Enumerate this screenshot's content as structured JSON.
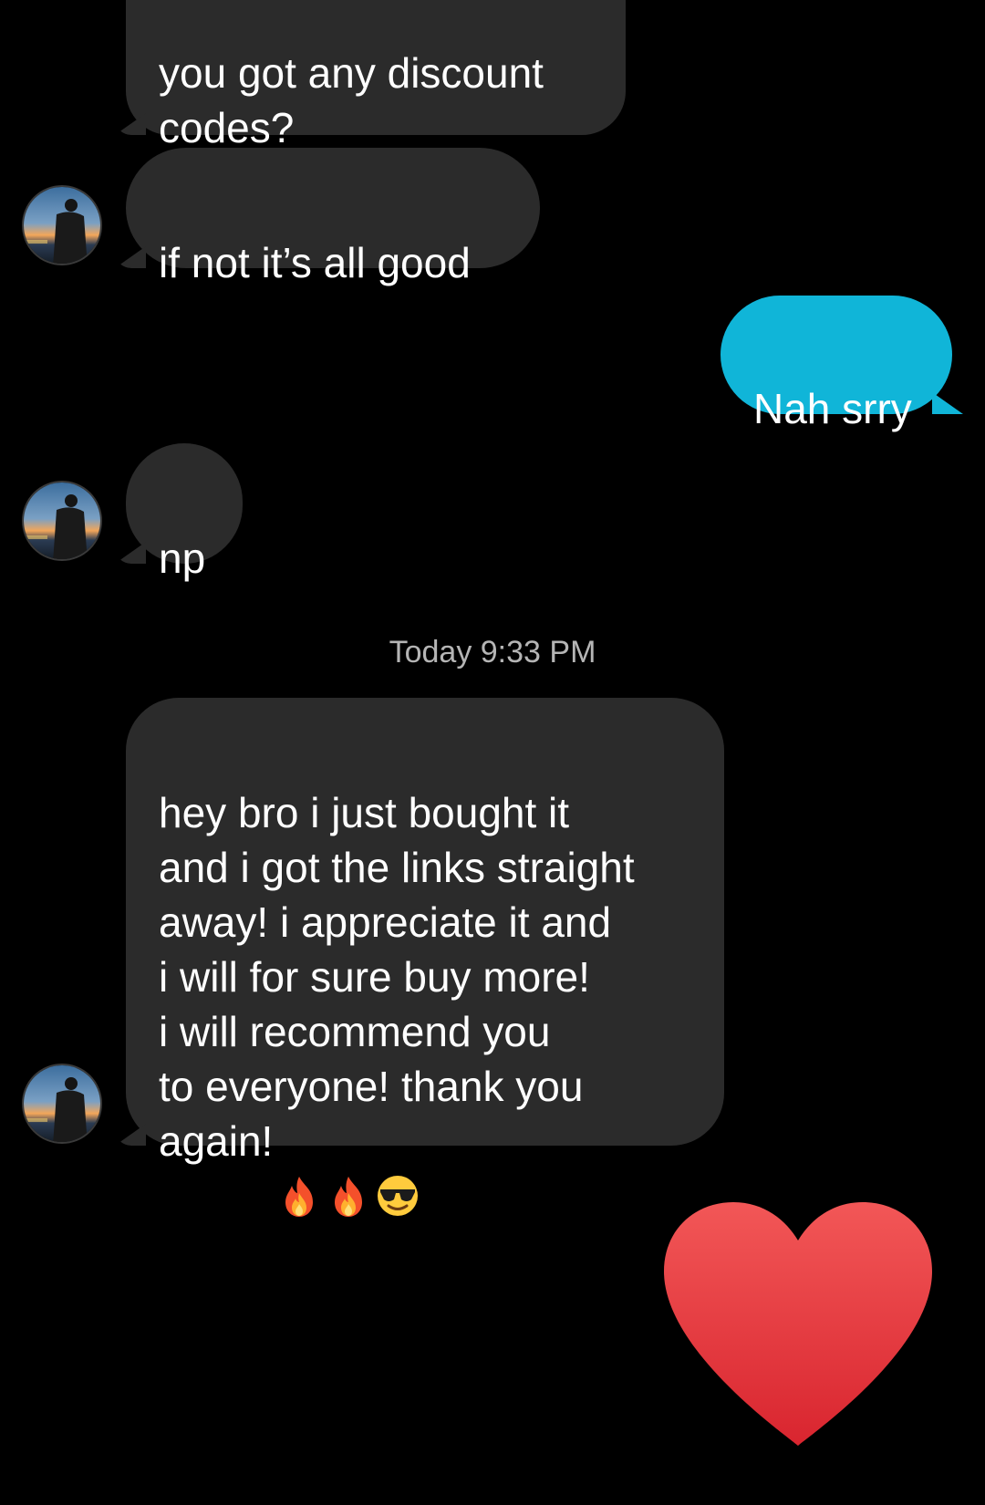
{
  "messages": [
    {
      "id": "m1",
      "direction": "incoming",
      "text": "you got any discount\ncodes?"
    },
    {
      "id": "m2",
      "direction": "incoming",
      "text": "if not it’s all good"
    },
    {
      "id": "m3",
      "direction": "outgoing",
      "text": "Nah srry"
    },
    {
      "id": "m4",
      "direction": "incoming",
      "text": "np"
    },
    {
      "id": "m5",
      "direction": "incoming",
      "text": "hey bro i just bought it\nand i got the links straight\naway! i appreciate it and\ni will for sure buy more!\ni will recommend you\nto everyone! thank you\nagain!"
    }
  ],
  "timestamp": "Today 9:33 PM",
  "m5_emojis": [
    "fire-emoji",
    "fire-emoji",
    "sunglasses-emoji"
  ],
  "heart_reaction": "heart-icon",
  "colors": {
    "background": "#000000",
    "incoming_bubble": "#2b2b2b",
    "outgoing_bubble": "#10b5d8",
    "timestamp_text": "#b5b5b5",
    "heart": "#e8454b"
  }
}
